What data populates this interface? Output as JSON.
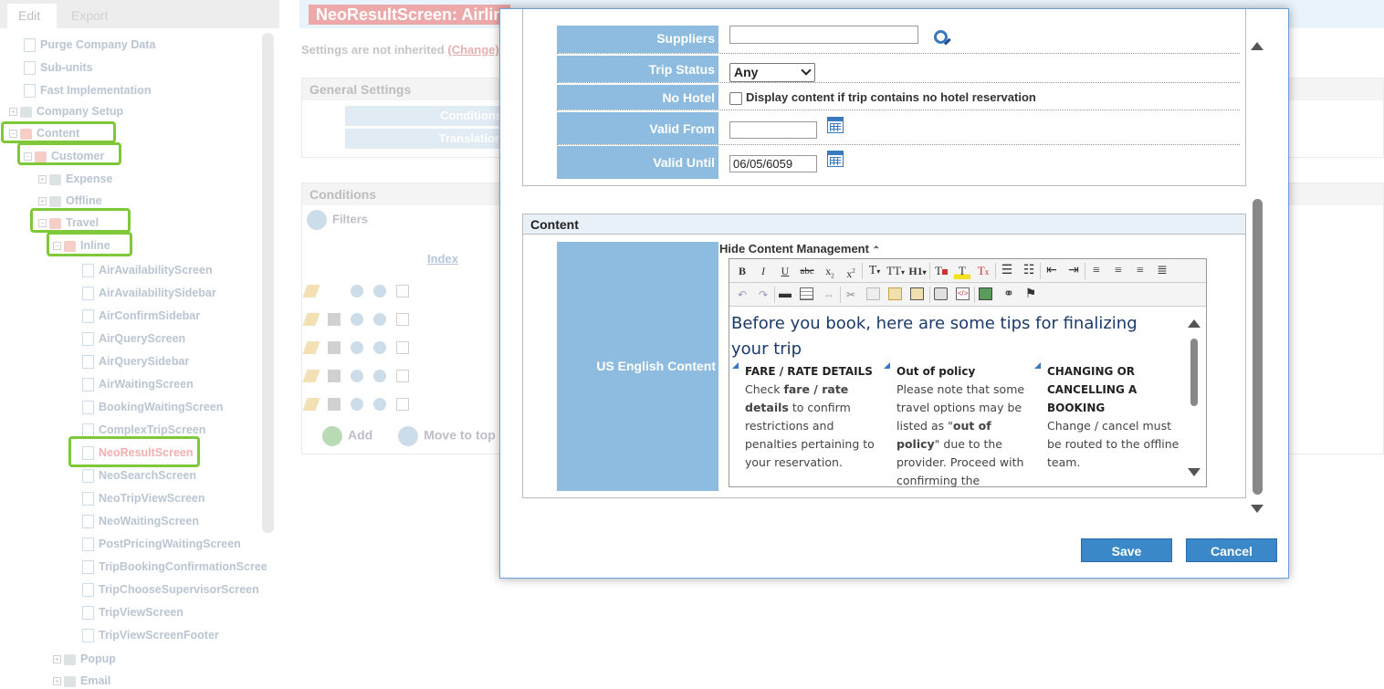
{
  "left_panel": {
    "tabs": [
      "Edit",
      "Export"
    ],
    "tree": [
      {
        "label": "Purge Company Data",
        "type": "page"
      },
      {
        "label": "Sub-units",
        "type": "page"
      },
      {
        "label": "Fast Implementation",
        "type": "page"
      },
      {
        "label": "Company Setup",
        "type": "folder"
      },
      {
        "label": "Content",
        "type": "open-folder"
      },
      {
        "label": "Customer",
        "type": "open-folder"
      },
      {
        "label": "Expense",
        "type": "folder"
      },
      {
        "label": "Offline",
        "type": "folder"
      },
      {
        "label": "Travel",
        "type": "open-folder"
      },
      {
        "label": "Inline",
        "type": "open-folder"
      },
      {
        "label": "AirAvailabilityScreen",
        "type": "page"
      },
      {
        "label": "AirAvailabilitySidebar",
        "type": "page"
      },
      {
        "label": "AirConfirmSidebar",
        "type": "page"
      },
      {
        "label": "AirQueryScreen",
        "type": "page"
      },
      {
        "label": "AirQuerySidebar",
        "type": "page"
      },
      {
        "label": "AirWaitingScreen",
        "type": "page"
      },
      {
        "label": "BookingWaitingScreen",
        "type": "page"
      },
      {
        "label": "ComplexTripScreen",
        "type": "page"
      },
      {
        "label": "NeoResultScreen",
        "type": "page",
        "selected": true
      },
      {
        "label": "NeoSearchScreen",
        "type": "page"
      },
      {
        "label": "NeoTripViewScreen",
        "type": "page"
      },
      {
        "label": "NeoWaitingScreen",
        "type": "page"
      },
      {
        "label": "PostPricingWaitingScreen",
        "type": "page"
      },
      {
        "label": "TripBookingConfirmationScree",
        "type": "page"
      },
      {
        "label": "TripChooseSupervisorScreen",
        "type": "page"
      },
      {
        "label": "TripViewScreen",
        "type": "page"
      },
      {
        "label": "TripViewScreenFooter",
        "type": "page"
      },
      {
        "label": "Popup",
        "type": "folder"
      },
      {
        "label": "Email",
        "type": "folder"
      }
    ]
  },
  "background": {
    "title": "NeoResultScreen: Airlin",
    "inherit_text": "Settings are not inherited",
    "inherit_link": "(Change)",
    "general_settings": "General Settings",
    "rows": [
      "Conditions",
      "Translation"
    ],
    "conditions_header": "Conditions",
    "filters": "Filters",
    "index_col": "Index",
    "add": "Add",
    "move_to_top": "Move to top"
  },
  "modal": {
    "fields": {
      "suppliers": {
        "label": "Suppliers",
        "value": ""
      },
      "trip_status": {
        "label": "Trip Status",
        "value": "Any"
      },
      "no_hotel": {
        "label": "No Hotel",
        "checkbox_text": "Display content if trip contains no hotel reservation",
        "checked": false
      },
      "valid_from": {
        "label": "Valid From",
        "value": ""
      },
      "valid_until": {
        "label": "Valid Until",
        "value": "06/05/6059"
      }
    },
    "content_section": {
      "header": "Content",
      "label": "US English Content",
      "hide_link": "Hide Content Management"
    },
    "editor": {
      "heading": "Before you book, here are some tips for finalizing your trip",
      "columns": [
        {
          "title": "FARE / RATE DETAILS",
          "text_before": "Check ",
          "bold": "fare / rate details",
          "text_after": " to confirm restrictions and penalties pertaining to your reservation."
        },
        {
          "title": "Out of policy",
          "text_before": "Please note that some travel options may be listed as \"",
          "bold": "out of policy",
          "text_after": "\" due to the provider. Proceed with confirming the"
        },
        {
          "title": "CHANGING OR CANCELLING A BOOKING",
          "text_before": "Change / cancel must be routed to the offline team.",
          "bold": "",
          "text_after": ""
        }
      ]
    },
    "buttons": {
      "save": "Save",
      "cancel": "Cancel"
    }
  }
}
